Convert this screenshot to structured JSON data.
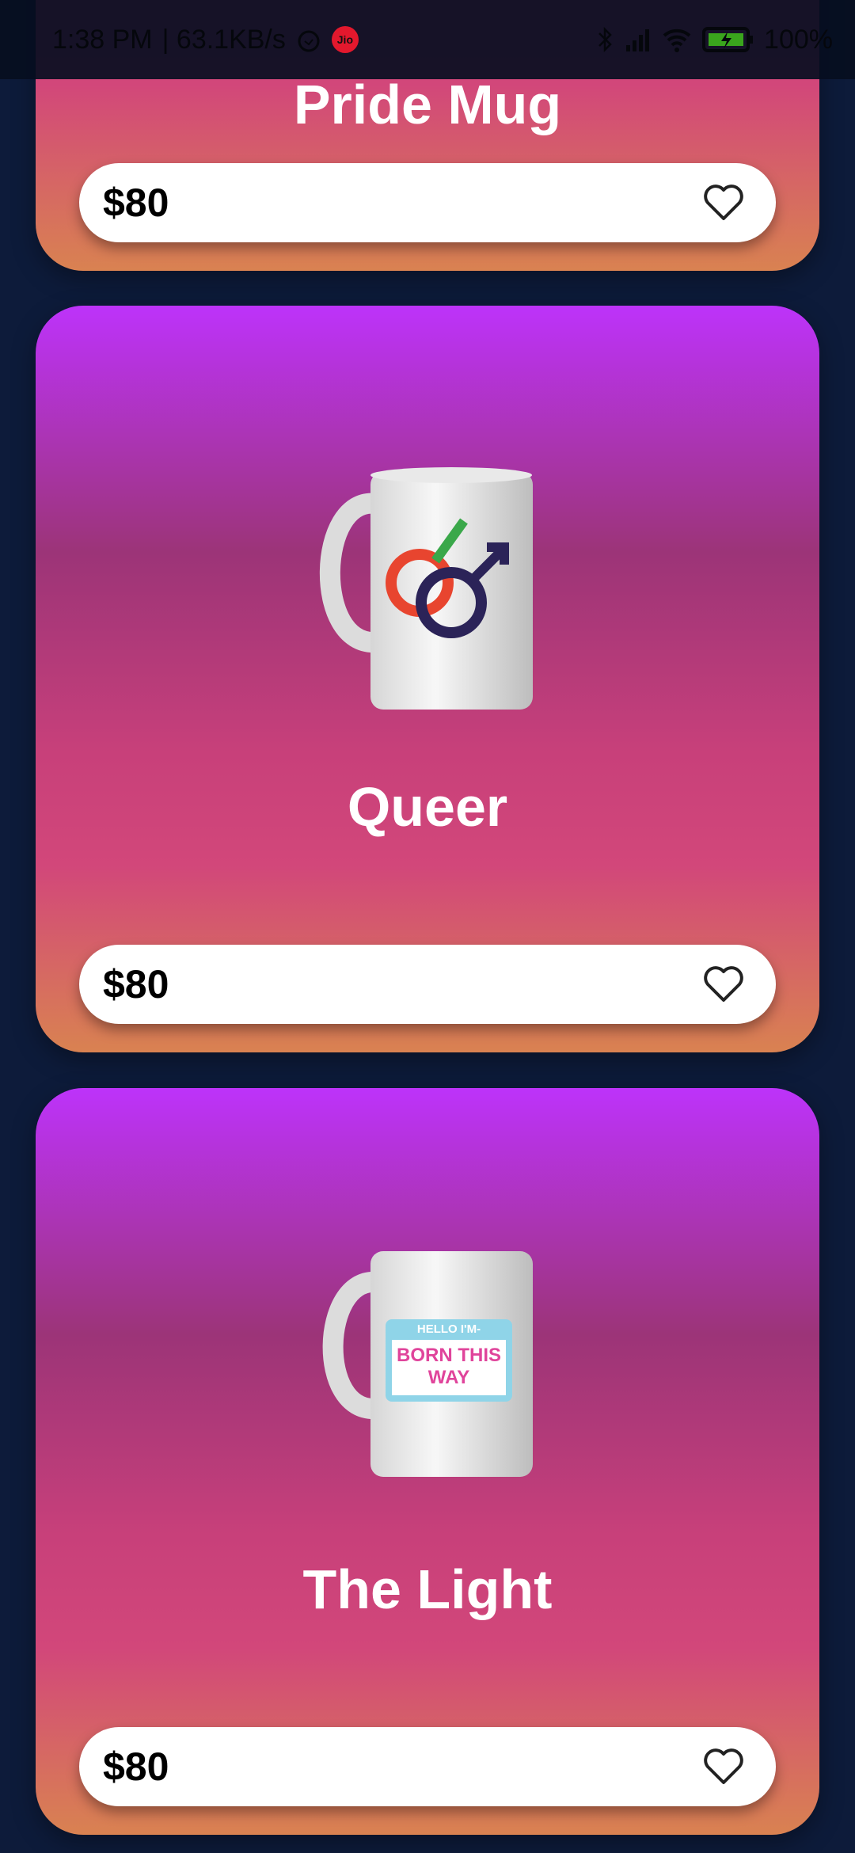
{
  "status_bar": {
    "time": "1:38 PM",
    "speed": "| 63.1KB/s",
    "carrier_badge": "Jio",
    "battery": "100%",
    "icons": [
      "alarm-icon",
      "bluetooth-icon",
      "signal-icon",
      "wifi-icon",
      "battery-charging-icon"
    ]
  },
  "colors": {
    "background": "#0d1b3a",
    "gradient": [
      "#bd33fa",
      "#9c3478",
      "#d2477a",
      "#d98251"
    ]
  },
  "products": [
    {
      "name": "Pride Mug",
      "price": "$80"
    },
    {
      "name": "Queer",
      "price": "$80"
    },
    {
      "name": "The Light",
      "price": "$80",
      "mug_text": [
        "HELLO I'M-",
        "BORN THIS",
        "WAY"
      ]
    }
  ]
}
